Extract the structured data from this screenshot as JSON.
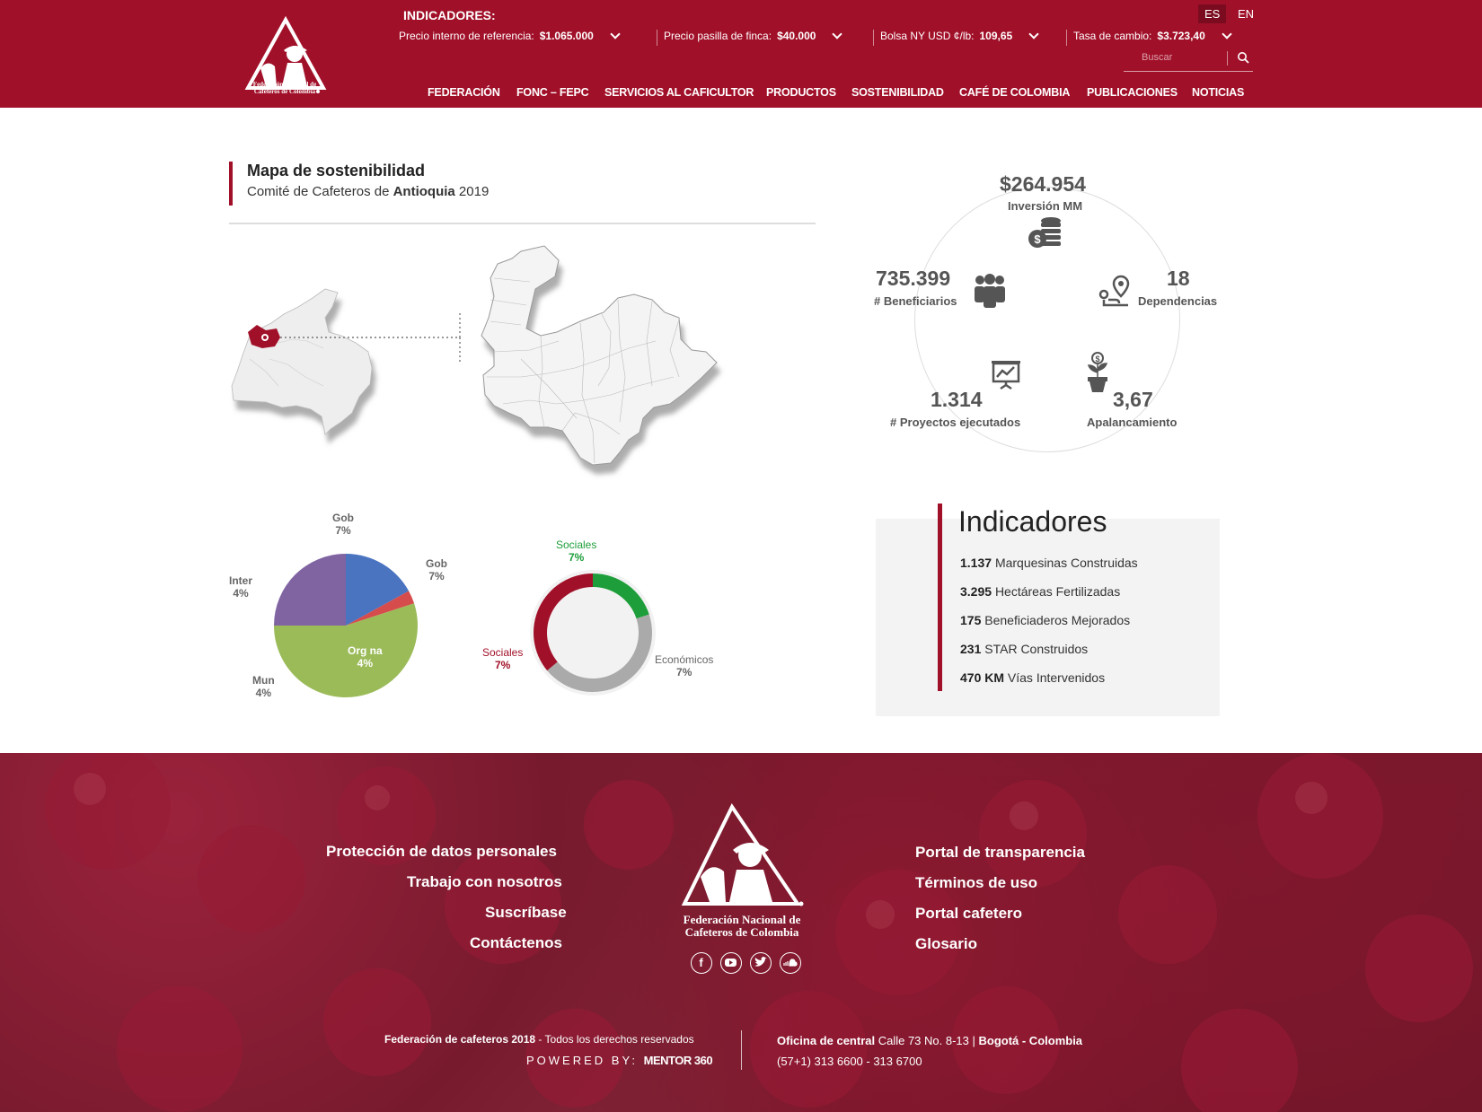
{
  "header": {
    "org_line1": "Federación Nacional de",
    "org_line2": "Cafeteros de Colombia",
    "indicators_title": "INDICADORES:",
    "indicators": [
      {
        "label": "Precio interno de referencia:",
        "value": "$1.065.000"
      },
      {
        "label": "Precio pasilla de finca:",
        "value": "$40.000"
      },
      {
        "label": "Bolsa NY USD ¢/lb:",
        "value": "109,65"
      },
      {
        "label": "Tasa de cambio:",
        "value": "$3.723,40"
      }
    ],
    "lang_es": "ES",
    "lang_en": "EN",
    "search_placeholder": "Buscar",
    "nav": [
      "FEDERACIÓN",
      "FONC – FEPC",
      "SERVICIOS AL CAFICULTOR",
      "PRODUCTOS",
      "SOSTENIBILIDAD",
      "CAFÉ DE COLOMBIA",
      "PUBLICACIONES",
      "NOTICIAS"
    ]
  },
  "section": {
    "title": "Mapa de sostenibilidad",
    "subtitle_pre": "Comité de Cafeteros de ",
    "subtitle_bold": "Antioquia",
    "subtitle_post": " 2019"
  },
  "stats": {
    "investment": {
      "value": "$264.954",
      "label": "Inversión MM"
    },
    "beneficiaries": {
      "value": "735.399",
      "label": "# Beneficiarios"
    },
    "dependencies": {
      "value": "18",
      "label": "Dependencias"
    },
    "projects": {
      "value": "1.314",
      "label": "# Proyectos ejecutados"
    },
    "leverage": {
      "value": "3,67",
      "label": "Apalancamiento"
    }
  },
  "indicators_box": {
    "title": "Indicadores",
    "rows": [
      {
        "value": "1.137",
        "label": "Marquesinas Construidas"
      },
      {
        "value": "3.295",
        "label": "Hectáreas Fertilizadas"
      },
      {
        "value": "175",
        "label": "Beneficiaderos Mejorados"
      },
      {
        "value": "231",
        "label": "STAR Construidos"
      },
      {
        "value": "470 KM",
        "label": "Vías Intervenidos"
      }
    ]
  },
  "chart_data": [
    {
      "type": "pie",
      "slices": [
        {
          "name": "Gob",
          "label": "7%",
          "value": 17,
          "color": "#4a73c0"
        },
        {
          "name": "Gob",
          "label": "7%",
          "value": 3,
          "color": "#d64b4b"
        },
        {
          "name": "Org na",
          "label": "4%",
          "value": 55,
          "color": "#9bbb59"
        },
        {
          "name": "Mun",
          "label": "4%",
          "value": 0,
          "color": "#9bbb59"
        },
        {
          "name": "Inter",
          "label": "4%",
          "value": 25,
          "color": "#8064a2"
        }
      ]
    },
    {
      "type": "pie",
      "donut": true,
      "slices": [
        {
          "name": "Sociales",
          "label": "7%",
          "value": 20,
          "color": "#1e9e3a"
        },
        {
          "name": "Económicos",
          "label": "7%",
          "value": 44,
          "color": "#aaaaaa"
        },
        {
          "name": "Sociales",
          "label": "7%",
          "value": 36,
          "color": "#a11029"
        }
      ]
    }
  ],
  "footer": {
    "links_left": [
      "Protección de datos personales",
      "Trabajo con nosotros",
      "Suscríbase",
      "Contáctenos"
    ],
    "links_right": [
      "Portal de transparencia",
      "Términos de uso",
      "Portal cafetero",
      "Glosario"
    ],
    "org_line1": "Federación Nacional de",
    "org_line2": "Cafeteros de Colombia",
    "copyright_bold": "Federación de cafeteros 2018",
    "copyright_rest": " - Todos los derechos reservados",
    "powered_label": "POWERED BY:",
    "powered_brand": "MENTOR 360",
    "office_bold": "Oficina de central",
    "office_addr": " Calle 73 No. 8-13  |  ",
    "office_city": "Bogotá - Colombia",
    "phones": "(57+1) 313 6600 - 313 6700"
  }
}
